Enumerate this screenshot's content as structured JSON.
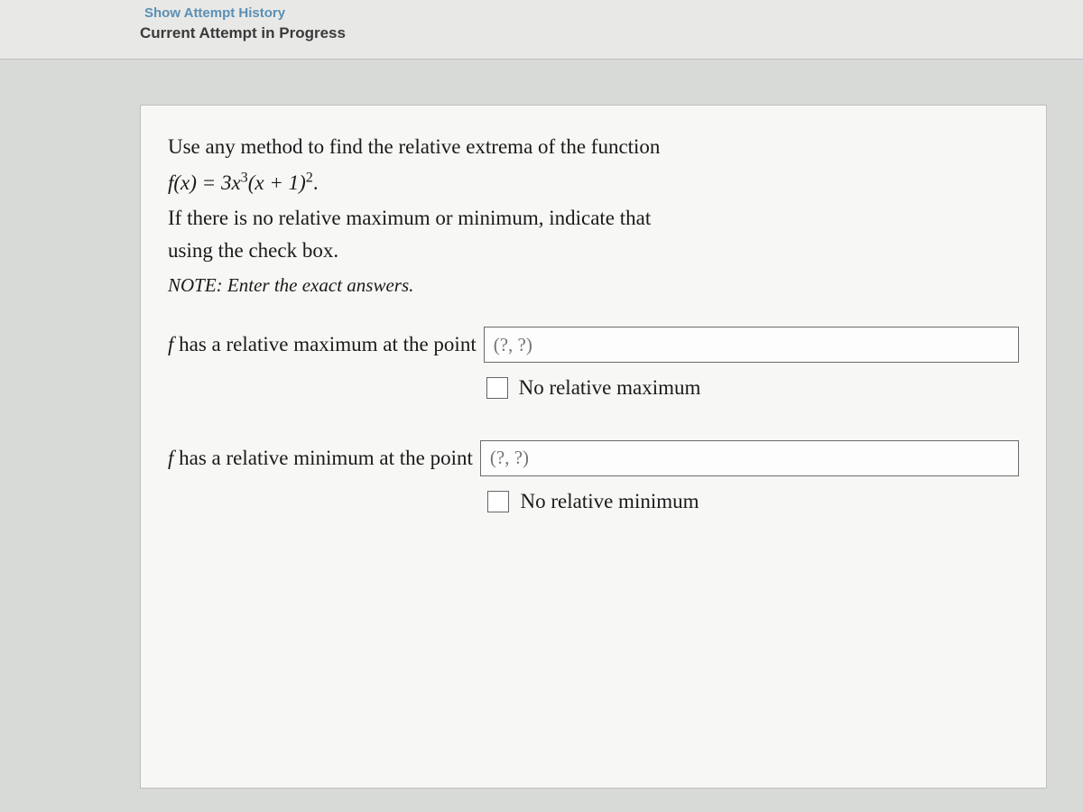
{
  "header": {
    "history_link": "Show Attempt History",
    "attempt_label": "Current Attempt in Progress"
  },
  "question": {
    "prompt": "Use any method to find the relative extrema of the function",
    "func_lhs": "f(x) = 3x",
    "exp1": "3",
    "func_mid": "(x + 1)",
    "exp2": "2",
    "func_end": ".",
    "instr1": "If there is no relative maximum or minimum, indicate that",
    "instr2": "using the check box.",
    "note": "NOTE: Enter the exact answers."
  },
  "answers": {
    "max_prefix_f": "f",
    "max_prefix": " has a relative maximum at the point",
    "max_placeholder": "(?, ?)",
    "no_max_label": "No relative maximum",
    "min_prefix_f": "f",
    "min_prefix": " has a relative minimum at the point",
    "min_placeholder": "(?, ?)",
    "no_min_label": "No relative minimum"
  }
}
